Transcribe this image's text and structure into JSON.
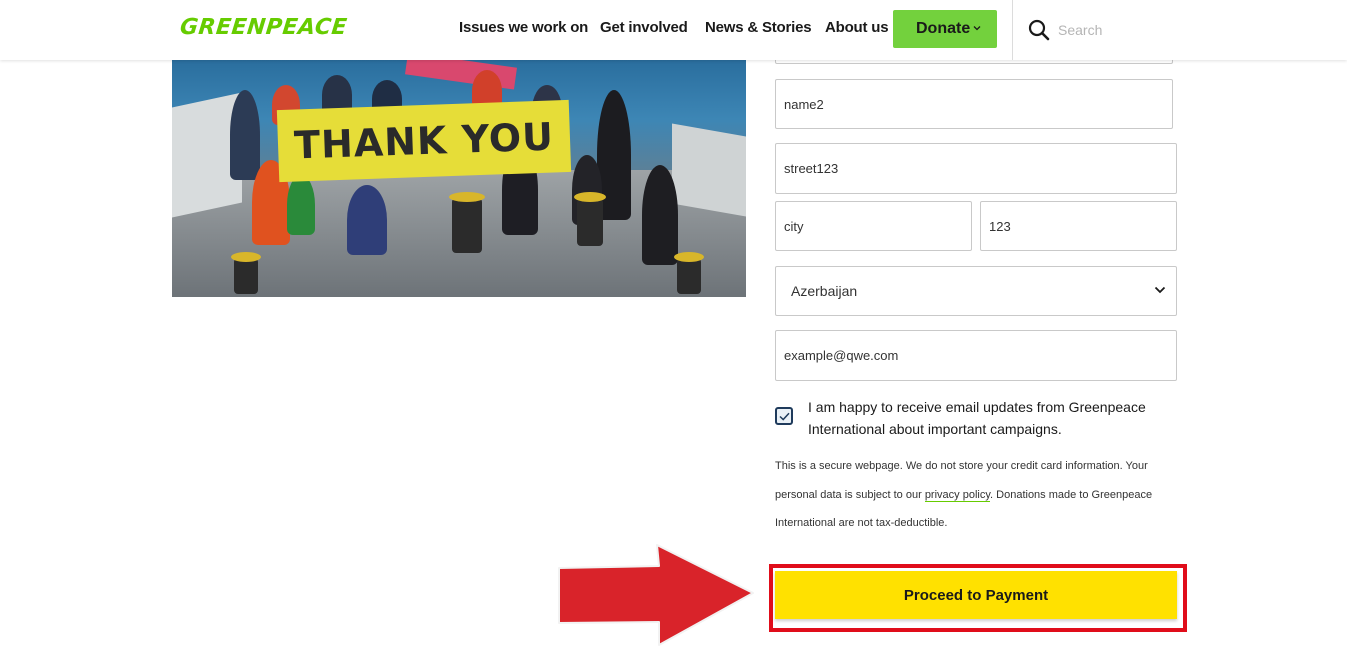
{
  "header": {
    "logo": "GREENPEACE",
    "nav": [
      {
        "label": "Issues we work on"
      },
      {
        "label": "Get involved"
      },
      {
        "label": "News & Stories"
      },
      {
        "label": "About us"
      }
    ],
    "donate_label": "Donate",
    "search_placeholder": "Search",
    "brand_color": "#66cc00",
    "donate_color": "#73d13d"
  },
  "photo": {
    "banner_text": "THANK YOU"
  },
  "form": {
    "last_name": "name2",
    "street": "street123",
    "city": "city",
    "zip": "123",
    "country": "Azerbaijan",
    "email": "example@qwe.com",
    "consent_checked": true,
    "consent_text": "I am happy to receive email updates from Greenpeace International about important campaigns.",
    "secure_text_before": "This is a secure webpage. We do not store your credit card information. Your personal data is subject to our ",
    "privacy_link": "privacy policy",
    "secure_text_after": ". Donations made to Greenpeace International are not tax-deductible.",
    "proceed_label": "Proceed to Payment",
    "proceed_color": "#ffe100",
    "highlight_color": "#e00d1a"
  }
}
